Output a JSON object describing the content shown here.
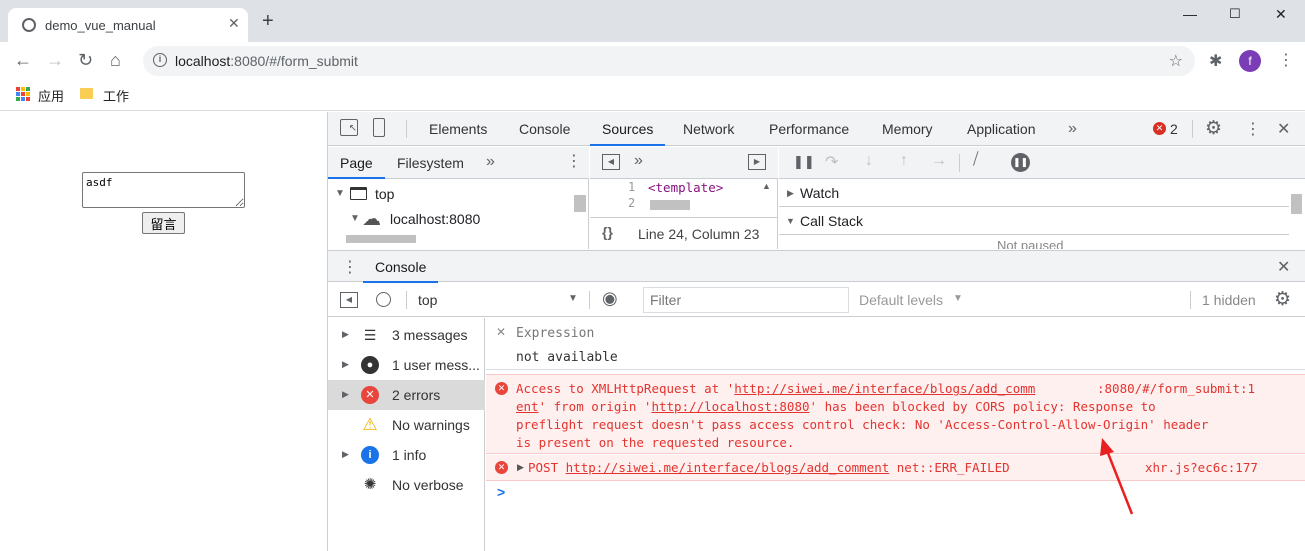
{
  "browser": {
    "tab_title": "demo_vue_manual",
    "url_host": "localhost",
    "url_path": ":8080/#/form_submit",
    "avatar_letter": "f",
    "bookmarks": [
      "应用",
      "工作"
    ]
  },
  "page": {
    "textarea_value": "asdf",
    "submit_label": "留言"
  },
  "devtools": {
    "tabs": [
      "Elements",
      "Console",
      "Sources",
      "Network",
      "Performance",
      "Memory",
      "Application"
    ],
    "active_tab": "Sources",
    "error_count": "2",
    "sources": {
      "nav_tabs": [
        "Page",
        "Filesystem"
      ],
      "tree": [
        "top",
        "localhost:8080"
      ],
      "editor_line1": "<template>",
      "line_numbers": [
        "1",
        "2"
      ],
      "cursor_position": "Line 24, Column 23",
      "debugger_sections": [
        "Watch",
        "Call Stack"
      ],
      "not_paused_partial": "Not paused"
    },
    "drawer": {
      "tab": "Console",
      "context": "top",
      "filter_placeholder": "Filter",
      "levels": "Default levels",
      "hidden": "1 hidden",
      "sidebar": [
        {
          "label": "3 messages",
          "icon": "list-icon"
        },
        {
          "label": "1 user mess...",
          "icon": "user-icon"
        },
        {
          "label": "2 errors",
          "icon": "error-icon"
        },
        {
          "label": "No warnings",
          "icon": "warning-icon"
        },
        {
          "label": "1 info",
          "icon": "info-icon"
        },
        {
          "label": "No verbose",
          "icon": "bug-icon"
        }
      ],
      "expression_label": "Expression",
      "expression_value": "not available",
      "error1": {
        "part1": "Access to XMLHttpRequest at '",
        "link1": "http://siwei.me/interface/blogs/add_comm",
        "source": ":8080/#/form_submit:1",
        "link1b": "ent",
        "part2": "' from origin '",
        "link2": "http://localhost:8080",
        "part3": "' has been blocked by CORS policy: Response to",
        "line3": "preflight request doesn't pass access control check: No 'Access-Control-Allow-Origin' header",
        "line4": "is present on the requested resource."
      },
      "error2": {
        "method": "POST",
        "url": "http://siwei.me/interface/blogs/add_comment",
        "status": "net::ERR_FAILED",
        "source": "xhr.js?ec6c:177"
      },
      "prompt": ">"
    }
  },
  "colors": {
    "accent": "#1a73e8",
    "error_text": "#e3342f",
    "error_bg": "#fff0f0",
    "annotation_arrow": "#e8201f"
  }
}
